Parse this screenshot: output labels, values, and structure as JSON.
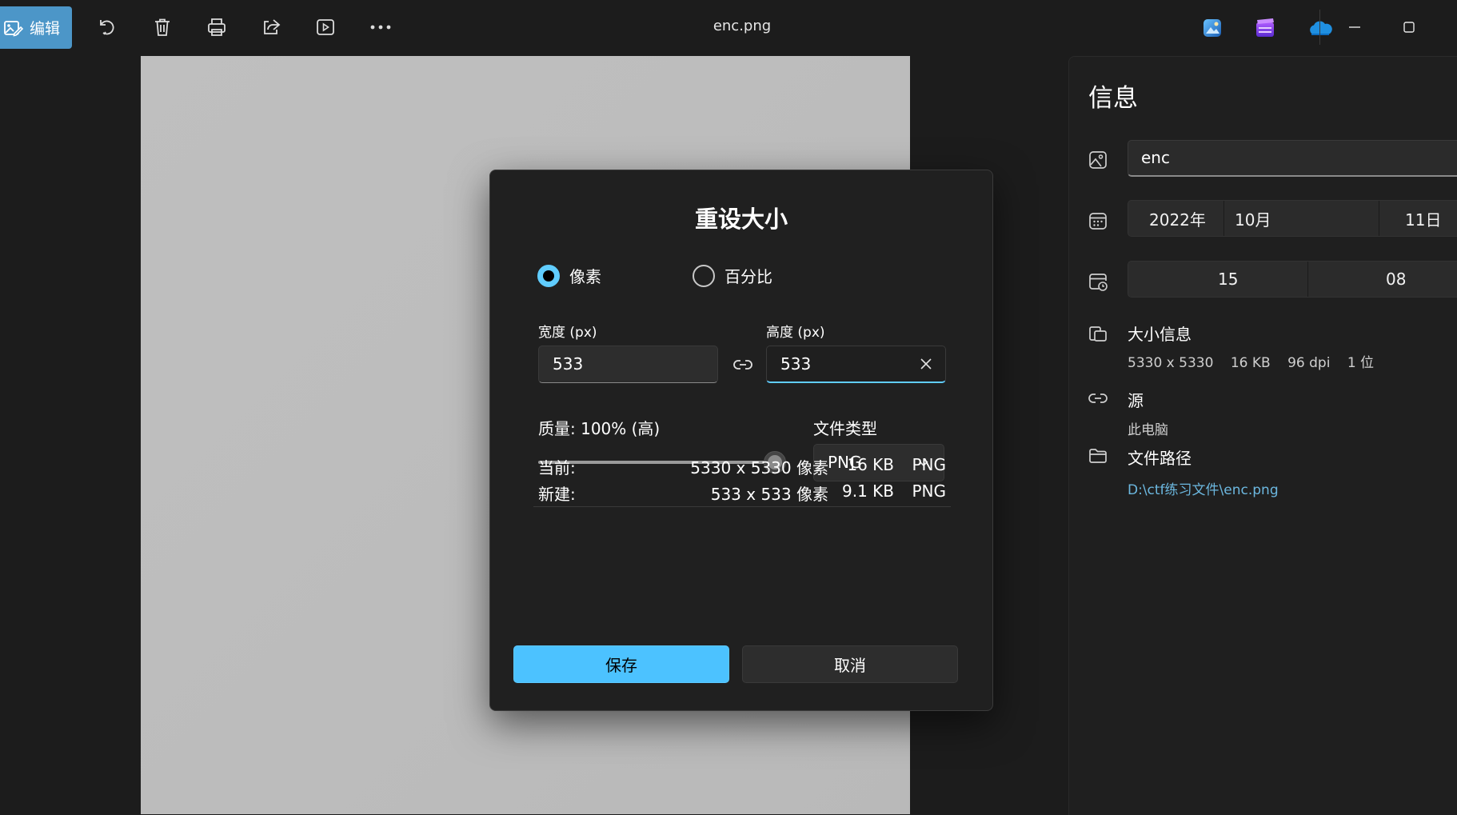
{
  "toolbar": {
    "edit_label": "编辑",
    "file_title": "enc.png",
    "icons": [
      "edit-icon",
      "rotate-icon",
      "delete-icon",
      "print-icon",
      "share-icon",
      "slideshow-icon",
      "more-icon",
      "photos-app-icon",
      "clipchamp-icon",
      "onedrive-icon",
      "minimize-icon",
      "maximize-icon"
    ]
  },
  "info_panel": {
    "title": "信息",
    "name_value": "enc",
    "date": {
      "year": "2022年",
      "month": "10月",
      "day": "11日"
    },
    "time": {
      "hour": "15",
      "minute": "08"
    },
    "size_info": {
      "label": "大小信息",
      "dimensions": "5330 x 5330",
      "file_size": "16 KB",
      "dpi": "96 dpi",
      "bit_depth": "1 位"
    },
    "source": {
      "label": "源",
      "value": "此电脑"
    },
    "file_path": {
      "label": "文件路径",
      "value": "D:\\ctf练习文件\\enc.png"
    }
  },
  "dialog": {
    "title": "重设大小",
    "mode_options": [
      {
        "label": "像素",
        "selected": true
      },
      {
        "label": "百分比",
        "selected": false
      }
    ],
    "width_label": "宽度 (px)",
    "width_value": "533",
    "height_label": "高度 (px)",
    "height_value": "533",
    "quality_label": "质量: 100% (高)",
    "quality_percent": 100,
    "filetype_label": "文件类型",
    "filetype_value": "PNG",
    "current": {
      "label": "当前:",
      "dimensions": "5330 x 5330 像素",
      "size": "16 KB",
      "type": "PNG"
    },
    "new": {
      "label": "新建:",
      "dimensions": "533 x 533 像素",
      "size": "9.1 KB",
      "type": "PNG"
    },
    "save_label": "保存",
    "cancel_label": "取消"
  },
  "colors": {
    "accent": "#60cdff",
    "save_button": "#4cc2ff",
    "edit_button": "#4c96c8",
    "link_text": "#6cb8e0",
    "background": "#1c1c1c"
  }
}
